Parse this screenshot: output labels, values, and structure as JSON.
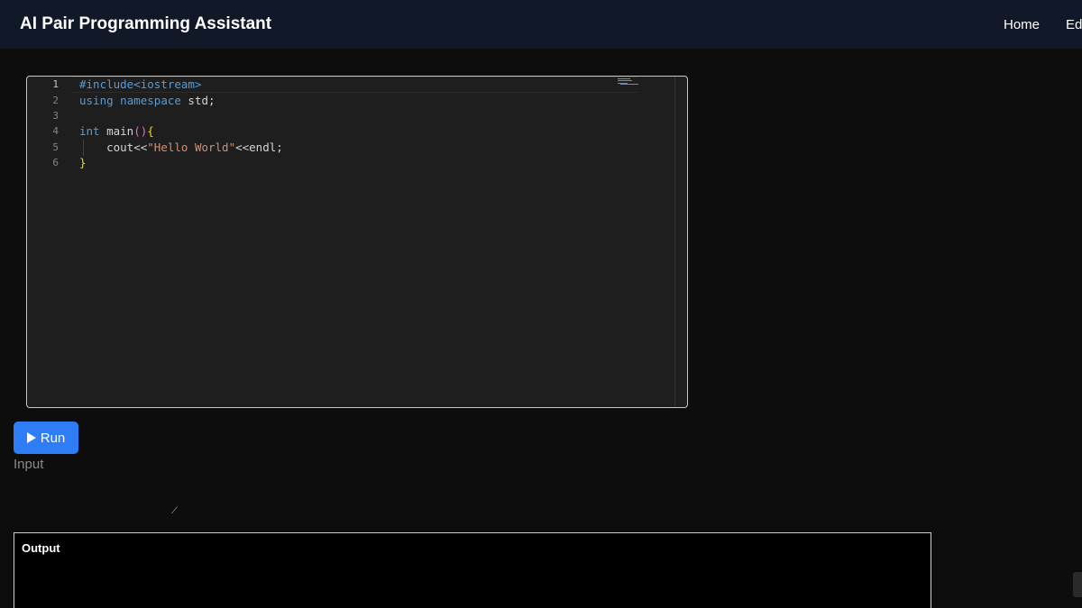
{
  "header": {
    "title": "AI Pair Programming Assistant",
    "nav": [
      {
        "label": "Home"
      },
      {
        "label": "Ed"
      }
    ]
  },
  "editor": {
    "language": "cpp",
    "line_numbers": [
      "1",
      "2",
      "3",
      "4",
      "5",
      "6"
    ],
    "lines": [
      "#include<iostream>",
      "using namespace std;",
      "",
      "int main(){",
      "    cout<<\"Hello World\"<<endl;",
      "}"
    ]
  },
  "run_button": {
    "label": "Run",
    "icon": "play-icon"
  },
  "input": {
    "label": "Input",
    "value": ""
  },
  "output": {
    "label": "Output",
    "text": ""
  },
  "colors": {
    "background": "#0d0d0d",
    "navbar": "#111827",
    "editor_bg": "#1e1e1e",
    "accent": "#2f7df6",
    "keyword": "#569cd6",
    "string": "#ce9178",
    "bracket": "#ffd700"
  }
}
